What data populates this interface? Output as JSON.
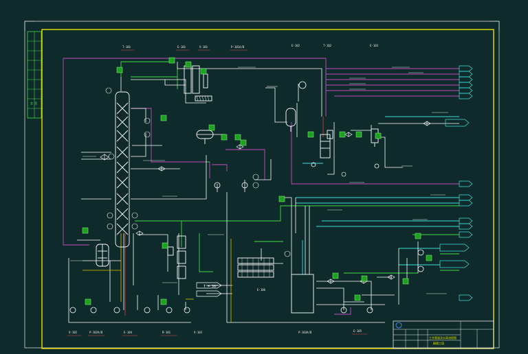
{
  "colors": {
    "background": "#0f2a2a",
    "frame": "#e8e8e8",
    "border": "#f0e000",
    "process": "#ffffff",
    "steam": "#c050c0",
    "water": "#40e0e0",
    "utility": "#40e040",
    "instrument_fill": "#20a020",
    "reflux": "#e04040",
    "tag_text": "#e0e000",
    "label_text": "#f0f0f0"
  },
  "drawing": {
    "side_strip_text": "会 签",
    "title_block_title": "工艺管道及仪表流程图",
    "title_block_sub": "精馏工段"
  },
  "equipment_tags": [
    "T-101",
    "E-101",
    "V-101",
    "P-101A/B",
    "E-102",
    "T-102",
    "E-103",
    "V-102",
    "P-102A/B",
    "E-104",
    "R-101",
    "V-103",
    "P-103A/B",
    "E-105"
  ],
  "special_tags": {
    "reflux_drum_label": "T = 30°",
    "cooler_label": "E-106"
  },
  "stream_labels": {
    "right_top": [
      "去火炬",
      "去罐区",
      "去罐区",
      "去罐区",
      "去罐区"
    ],
    "right_mid": [
      "去罐区",
      "去罐区",
      "去罐区",
      "去罐区",
      "去罐区"
    ],
    "right_low": [
      "去罐区",
      "去罐区"
    ]
  }
}
